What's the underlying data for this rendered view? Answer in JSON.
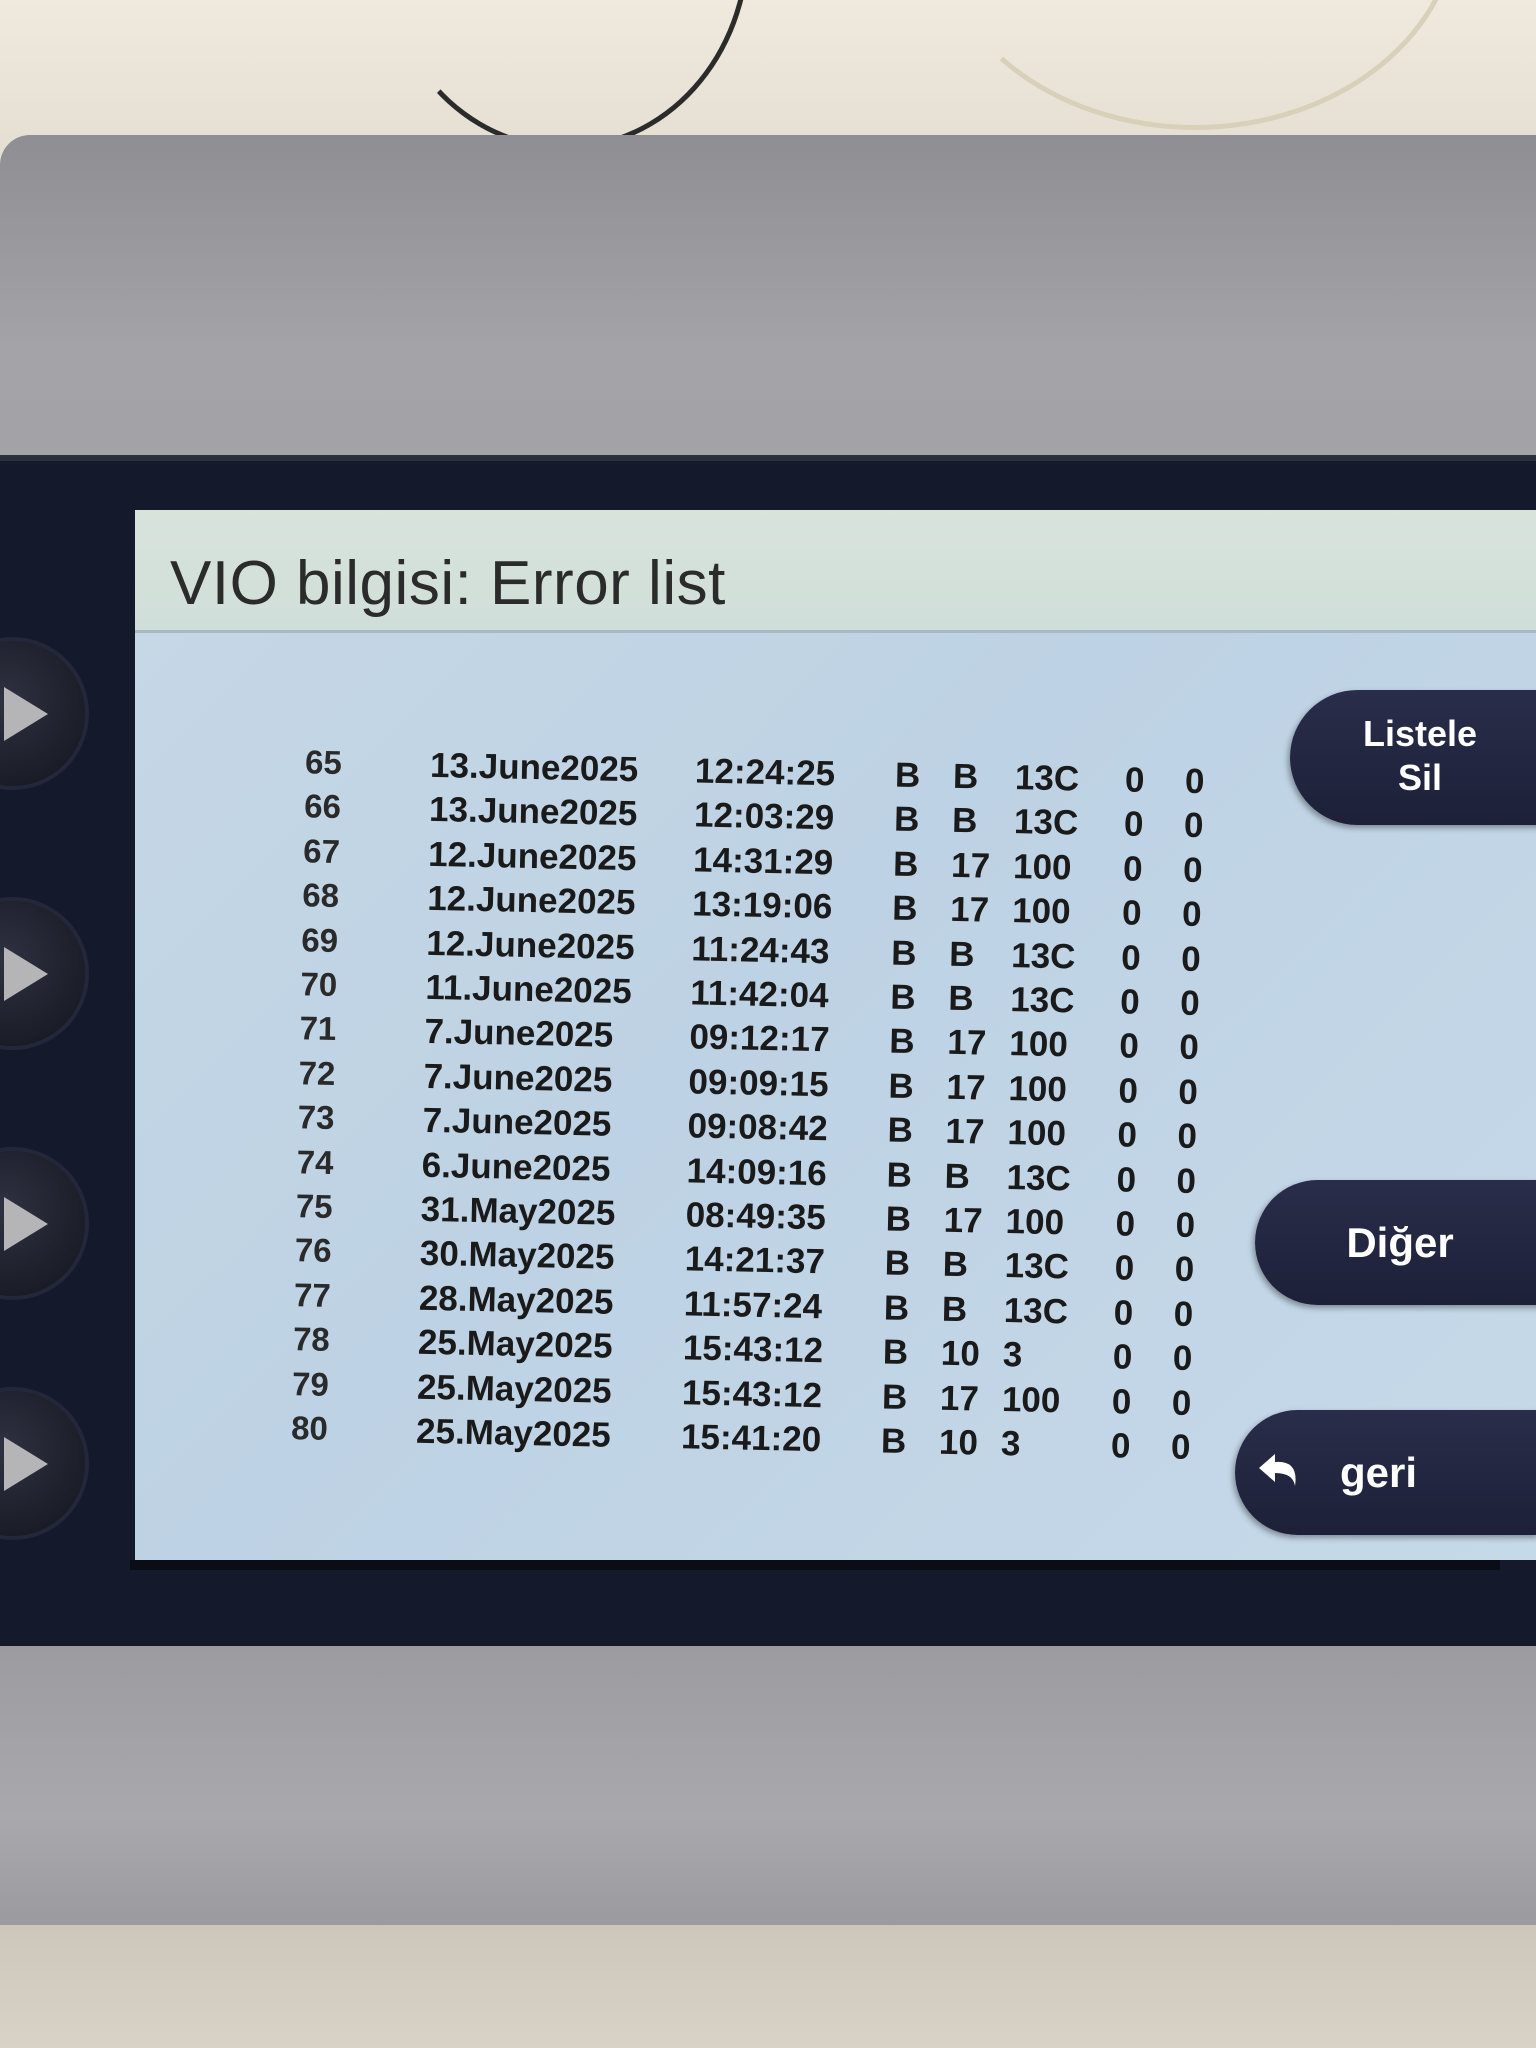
{
  "header": {
    "title": "VIO bilgisi: Error list"
  },
  "buttons": {
    "listele_line1": "Listele",
    "listele_line2": "Sil",
    "diger": "Diğer",
    "geri": "geri"
  },
  "icons": [
    "play-triangle-icon",
    "back-arrow-icon"
  ],
  "colors": {
    "screen_bg": "#c2d6e8",
    "title_bar": "#d5e1da",
    "button_bg": "#23263f",
    "bezel": "#141a2c"
  },
  "errors": [
    {
      "num": "65",
      "date": "13.June2025",
      "time": "12:24:25",
      "c1": "B",
      "c2": "B",
      "c3": "13C",
      "c4": "0",
      "c5": "0"
    },
    {
      "num": "66",
      "date": "13.June2025",
      "time": "12:03:29",
      "c1": "B",
      "c2": "B",
      "c3": "13C",
      "c4": "0",
      "c5": "0"
    },
    {
      "num": "67",
      "date": "12.June2025",
      "time": "14:31:29",
      "c1": "B",
      "c2": "17",
      "c3": "100",
      "c4": "0",
      "c5": "0"
    },
    {
      "num": "68",
      "date": "12.June2025",
      "time": "13:19:06",
      "c1": "B",
      "c2": "17",
      "c3": "100",
      "c4": "0",
      "c5": "0"
    },
    {
      "num": "69",
      "date": "12.June2025",
      "time": "11:24:43",
      "c1": "B",
      "c2": "B",
      "c3": "13C",
      "c4": "0",
      "c5": "0"
    },
    {
      "num": "70",
      "date": "11.June2025",
      "time": "11:42:04",
      "c1": "B",
      "c2": "B",
      "c3": "13C",
      "c4": "0",
      "c5": "0"
    },
    {
      "num": "71",
      "date": "7.June2025",
      "time": "09:12:17",
      "c1": "B",
      "c2": "17",
      "c3": "100",
      "c4": "0",
      "c5": "0"
    },
    {
      "num": "72",
      "date": "7.June2025",
      "time": "09:09:15",
      "c1": "B",
      "c2": "17",
      "c3": "100",
      "c4": "0",
      "c5": "0"
    },
    {
      "num": "73",
      "date": "7.June2025",
      "time": "09:08:42",
      "c1": "B",
      "c2": "17",
      "c3": "100",
      "c4": "0",
      "c5": "0"
    },
    {
      "num": "74",
      "date": "6.June2025",
      "time": "14:09:16",
      "c1": "B",
      "c2": "B",
      "c3": "13C",
      "c4": "0",
      "c5": "0"
    },
    {
      "num": "75",
      "date": "31.May2025",
      "time": "08:49:35",
      "c1": "B",
      "c2": "17",
      "c3": "100",
      "c4": "0",
      "c5": "0"
    },
    {
      "num": "76",
      "date": "30.May2025",
      "time": "14:21:37",
      "c1": "B",
      "c2": "B",
      "c3": "13C",
      "c4": "0",
      "c5": "0"
    },
    {
      "num": "77",
      "date": "28.May2025",
      "time": "11:57:24",
      "c1": "B",
      "c2": "B",
      "c3": "13C",
      "c4": "0",
      "c5": "0"
    },
    {
      "num": "78",
      "date": "25.May2025",
      "time": "15:43:12",
      "c1": "B",
      "c2": "10",
      "c3": "3",
      "c4": "0",
      "c5": "0"
    },
    {
      "num": "79",
      "date": "25.May2025",
      "time": "15:43:12",
      "c1": "B",
      "c2": "17",
      "c3": "100",
      "c4": "0",
      "c5": "0"
    },
    {
      "num": "80",
      "date": "25.May2025",
      "time": "15:41:20",
      "c1": "B",
      "c2": "10",
      "c3": "3",
      "c4": "0",
      "c5": "0"
    }
  ]
}
